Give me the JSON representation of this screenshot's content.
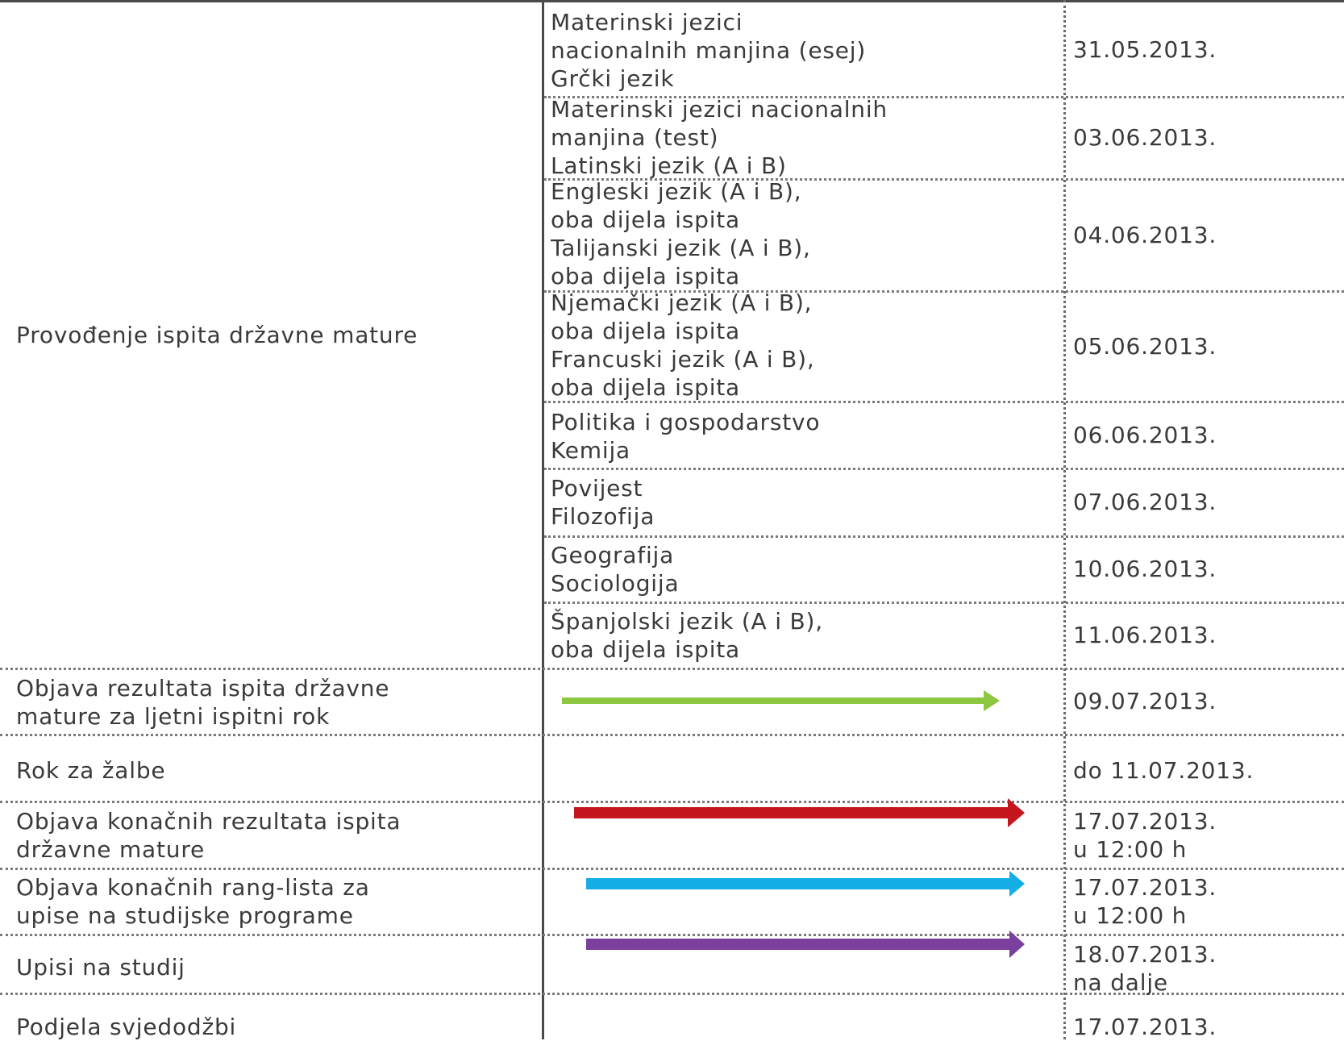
{
  "main_label": "Provođenje ispita državne mature",
  "exam_rows": [
    {
      "subjects": "Materinski jezici\nnacionalnih manjina (esej)\nGrčki jezik",
      "date": "31.05.2013."
    },
    {
      "subjects": "Materinski jezici nacionalnih\nmanjina (test)\nLatinski jezik (A i B)",
      "date": "03.06.2013."
    },
    {
      "subjects": "Engleski jezik (A i B),\noba dijela ispita\nTalijanski jezik (A i B),\noba dijela ispita",
      "date": "04.06.2013."
    },
    {
      "subjects": "Njemački jezik (A i B),\noba dijela ispita\nFrancuski jezik (A i B),\noba dijela ispita",
      "date": "05.06.2013."
    },
    {
      "subjects": "Politika i gospodarstvo\nKemija",
      "date": "06.06.2013."
    },
    {
      "subjects": "Povijest\nFilozofija",
      "date": "07.06.2013."
    },
    {
      "subjects": "Geografija\nSociologija",
      "date": "10.06.2013."
    },
    {
      "subjects": "Španjolski jezik (A i B),\noba dijela ispita",
      "date": "11.06.2013."
    }
  ],
  "event_rows": [
    {
      "label": "Objava rezultata ispita državne\nmature za ljetni ispitni rok",
      "date": "09.07.2013.",
      "arrow_color": "#8dc63f"
    },
    {
      "label": "Rok za žalbe",
      "date": "do 11.07.2013.",
      "arrow_color": ""
    },
    {
      "label": "Objava konačnih rezultata ispita\ndržavne mature",
      "date": "17.07.2013.\nu 12:00 h",
      "arrow_color": "#c4161c"
    },
    {
      "label": "Objava konačnih rang-lista za\nupise na studijske programe",
      "date": "17.07.2013.\nu 12:00 h",
      "arrow_color": "#14aee5"
    },
    {
      "label": "Upisi na studij",
      "date": "18.07.2013.\nna dalje",
      "arrow_color": "#7b3f9e"
    },
    {
      "label": "Podjela svjedodžbi",
      "date": "17.07.2013.",
      "arrow_color": ""
    }
  ]
}
